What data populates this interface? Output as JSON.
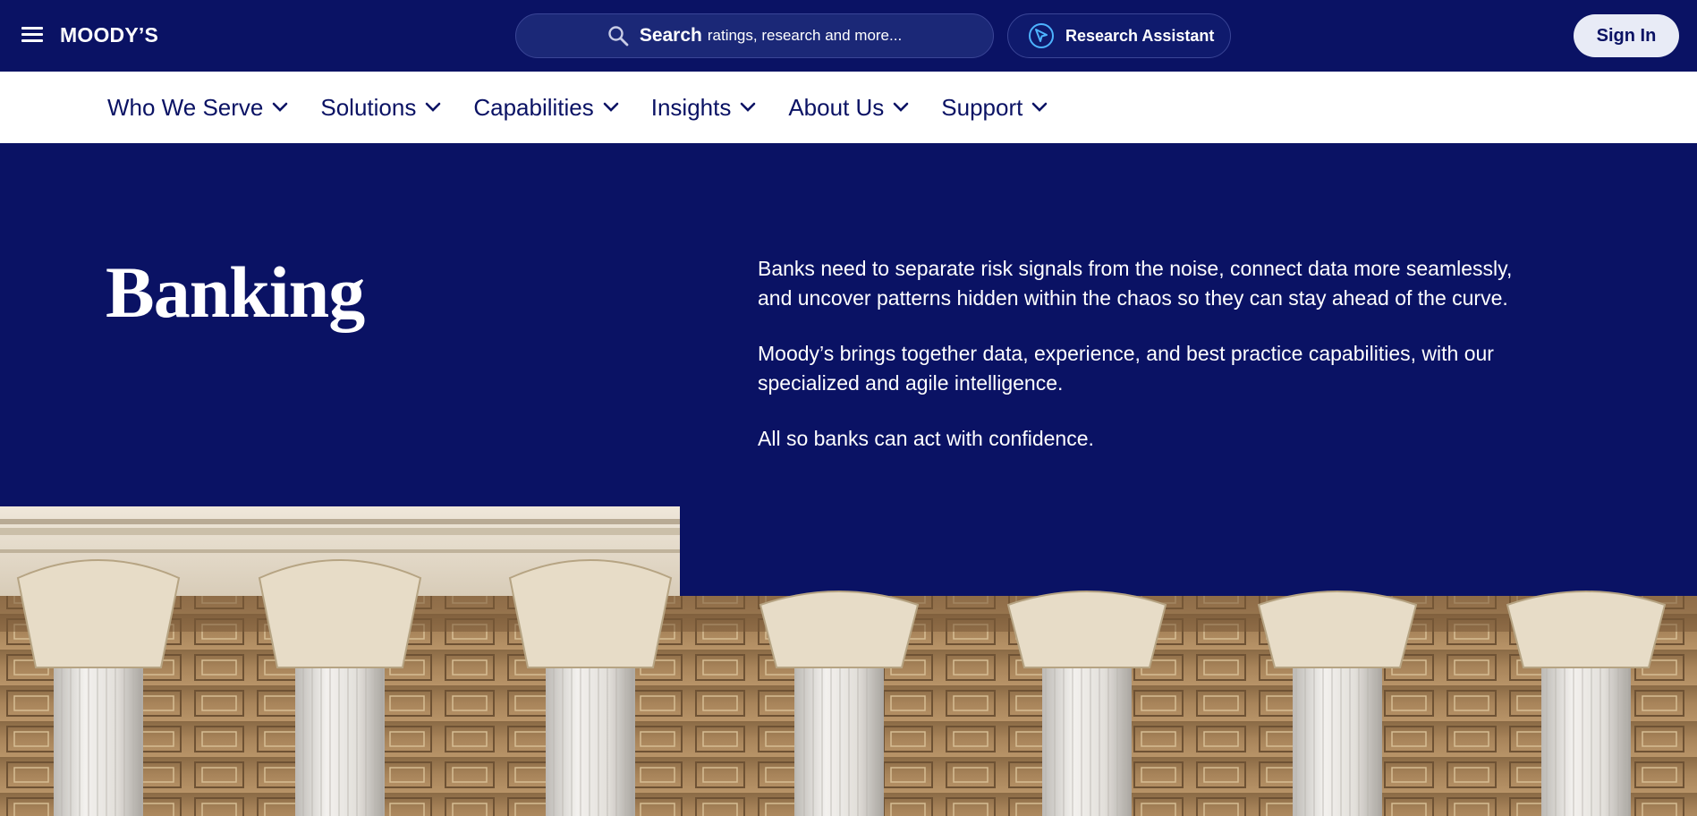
{
  "header": {
    "menu_icon": "hamburger-icon",
    "logo": "MOODY’S",
    "search": {
      "bold": "Search",
      "rest": "ratings, research and more...",
      "icon": "search-icon"
    },
    "assistant": {
      "label": "Research Assistant",
      "icon": "cursor-icon"
    },
    "signin": "Sign In"
  },
  "nav": {
    "items": [
      {
        "label": "Who We Serve"
      },
      {
        "label": "Solutions"
      },
      {
        "label": "Capabilities"
      },
      {
        "label": "Insights"
      },
      {
        "label": "About Us"
      },
      {
        "label": "Support"
      }
    ]
  },
  "hero": {
    "title": "Banking",
    "paragraphs": [
      "Banks need to separate risk signals from the noise, connect data more seamlessly, and uncover patterns hidden within the chaos so they can stay ahead of the curve.",
      "Moody’s brings together data, experience, and best practice capabilities, with our specialized and agile intelligence.",
      "All so banks can act with confidence."
    ]
  },
  "colors": {
    "brand_navy": "#0a1264",
    "white": "#ffffff",
    "pill_bg": "#e8ebf6"
  }
}
